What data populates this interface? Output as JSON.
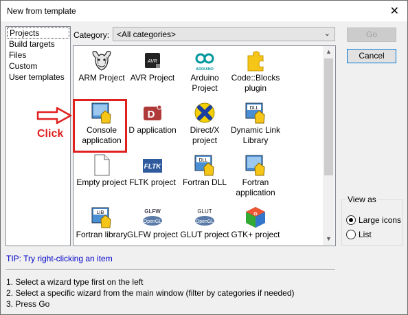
{
  "window": {
    "title": "New from template",
    "close_glyph": "✕"
  },
  "sidebar": {
    "items": [
      {
        "label": "Projects",
        "selected": true
      },
      {
        "label": "Build targets"
      },
      {
        "label": "Files"
      },
      {
        "label": "Custom"
      },
      {
        "label": "User templates"
      }
    ]
  },
  "category": {
    "label": "Category:",
    "value": "<All categories>"
  },
  "buttons": {
    "go": "Go",
    "cancel": "Cancel"
  },
  "templates": [
    {
      "label": "ARM Project",
      "icon": "gnu-icon"
    },
    {
      "label": "AVR Project",
      "icon": "avr-chip-icon"
    },
    {
      "label": "Arduino Project",
      "icon": "arduino-icon"
    },
    {
      "label": "Code::Blocks plugin",
      "icon": "puzzle-plugin-icon"
    },
    {
      "label": "Console application",
      "icon": "console-app-icon"
    },
    {
      "label": "D application",
      "icon": "d-lang-icon"
    },
    {
      "label": "Direct/X project",
      "icon": "directx-icon"
    },
    {
      "label": "Dynamic Link Library",
      "icon": "dll-icon"
    },
    {
      "label": "Empty project",
      "icon": "empty-file-icon"
    },
    {
      "label": "FLTK project",
      "icon": "fltk-icon"
    },
    {
      "label": "Fortran DLL",
      "icon": "fortran-dll-icon"
    },
    {
      "label": "Fortran application",
      "icon": "fortran-app-icon"
    },
    {
      "label": "Fortran library",
      "icon": "fortran-lib-icon"
    },
    {
      "label": "GLFW project",
      "icon": "glfw-opengl-icon"
    },
    {
      "label": "GLUT project",
      "icon": "glut-opengl-icon"
    },
    {
      "label": "GTK+ project",
      "icon": "gtk-icon"
    }
  ],
  "icon_text": {
    "avr": "AVR",
    "arduino": "ARDUINO",
    "dll": "DLL",
    "fltk": "FLTK",
    "lib": "LIB",
    "glfw": "GLFW",
    "glut": "GLUT",
    "opengl": "OpenGL"
  },
  "view_as": {
    "caption": "View as",
    "large": "Large icons",
    "list": "List",
    "selected": "large"
  },
  "tip": "TIP: Try right-clicking an item",
  "steps": [
    "1. Select a wizard type first on the left",
    "2. Select a specific wizard from the main window (filter by categories if needed)",
    "3. Press Go"
  ],
  "annotation": {
    "text": "Click",
    "color": "#e0201f"
  }
}
